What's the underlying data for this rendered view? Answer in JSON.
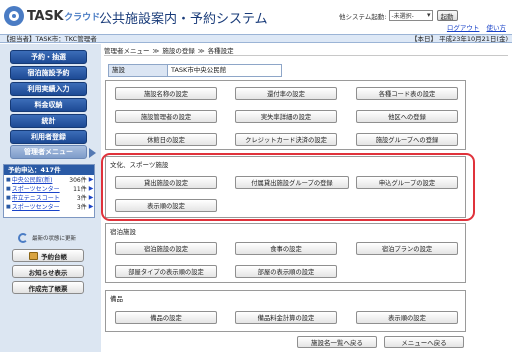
{
  "header": {
    "logo_task": "TASK",
    "logo_cloud": "クラウド",
    "title": "公共施設案内・予約システム",
    "sys_launch_label": "他システム起動:",
    "sys_launch_value": "-未選択-",
    "launch_button": "起動",
    "links": [
      "ログアウト",
      "使い方"
    ]
  },
  "infobar": {
    "left": "【担当者】TASK市：TKC管理者",
    "right": "【本日】 平成23年10月21日(金)"
  },
  "sidebar": {
    "menu": [
      {
        "label": "予約・抽選",
        "active": false
      },
      {
        "label": "宿泊施設予約",
        "active": false
      },
      {
        "label": "利用実績入力",
        "active": false
      },
      {
        "label": "料金収納",
        "active": false
      },
      {
        "label": "統計",
        "active": false
      },
      {
        "label": "利用者登録",
        "active": false
      },
      {
        "label": "管理者メニュー",
        "active": true
      }
    ],
    "notice": {
      "title": "予約申込：417件",
      "rows": [
        {
          "name": "中央公民館(新)",
          "count": "306件"
        },
        {
          "name": "スポーツセンター",
          "count": "11件"
        },
        {
          "name": "市立テニスコート",
          "count": "3件"
        },
        {
          "name": "スポーツセンター",
          "count": "3件"
        }
      ]
    },
    "refresh_label": "最新の状態に更新",
    "buttons": [
      "予約台帳",
      "お知らせ表示",
      "作成完了帳票"
    ]
  },
  "breadcrumb": [
    "管理者メニュー",
    "施設の登録",
    "各種設定"
  ],
  "facility": {
    "label": "施設",
    "value": "TASK市中央公民館"
  },
  "panels": {
    "general": [
      "施設名称の設定",
      "還付率の設定",
      "各種コード表の設定",
      "施設管理者の設定",
      "実失率詳細の設定",
      "他区への登録",
      "休館日の設定",
      "クレジットカード決済の設定",
      "施設グループへの登録"
    ],
    "sports": {
      "title": "文化、スポーツ施設",
      "buttons": [
        "貸出施設の設定",
        "付属貸出施設グループの登録",
        "申込グループの設定",
        "表示順の設定"
      ]
    },
    "lodging": {
      "title": "宿泊施設",
      "buttons": [
        "宿泊施設の設定",
        "食事の設定",
        "宿泊プランの設定",
        "部屋タイプの表示順の設定",
        "部屋の表示順の設定"
      ]
    },
    "equipment": {
      "title": "備品",
      "buttons": [
        "備品の設定",
        "備品料金計算の設定",
        "表示順の設定"
      ]
    }
  },
  "bottom_buttons": [
    "施設名一覧へ戻る",
    "メニューへ戻る"
  ]
}
